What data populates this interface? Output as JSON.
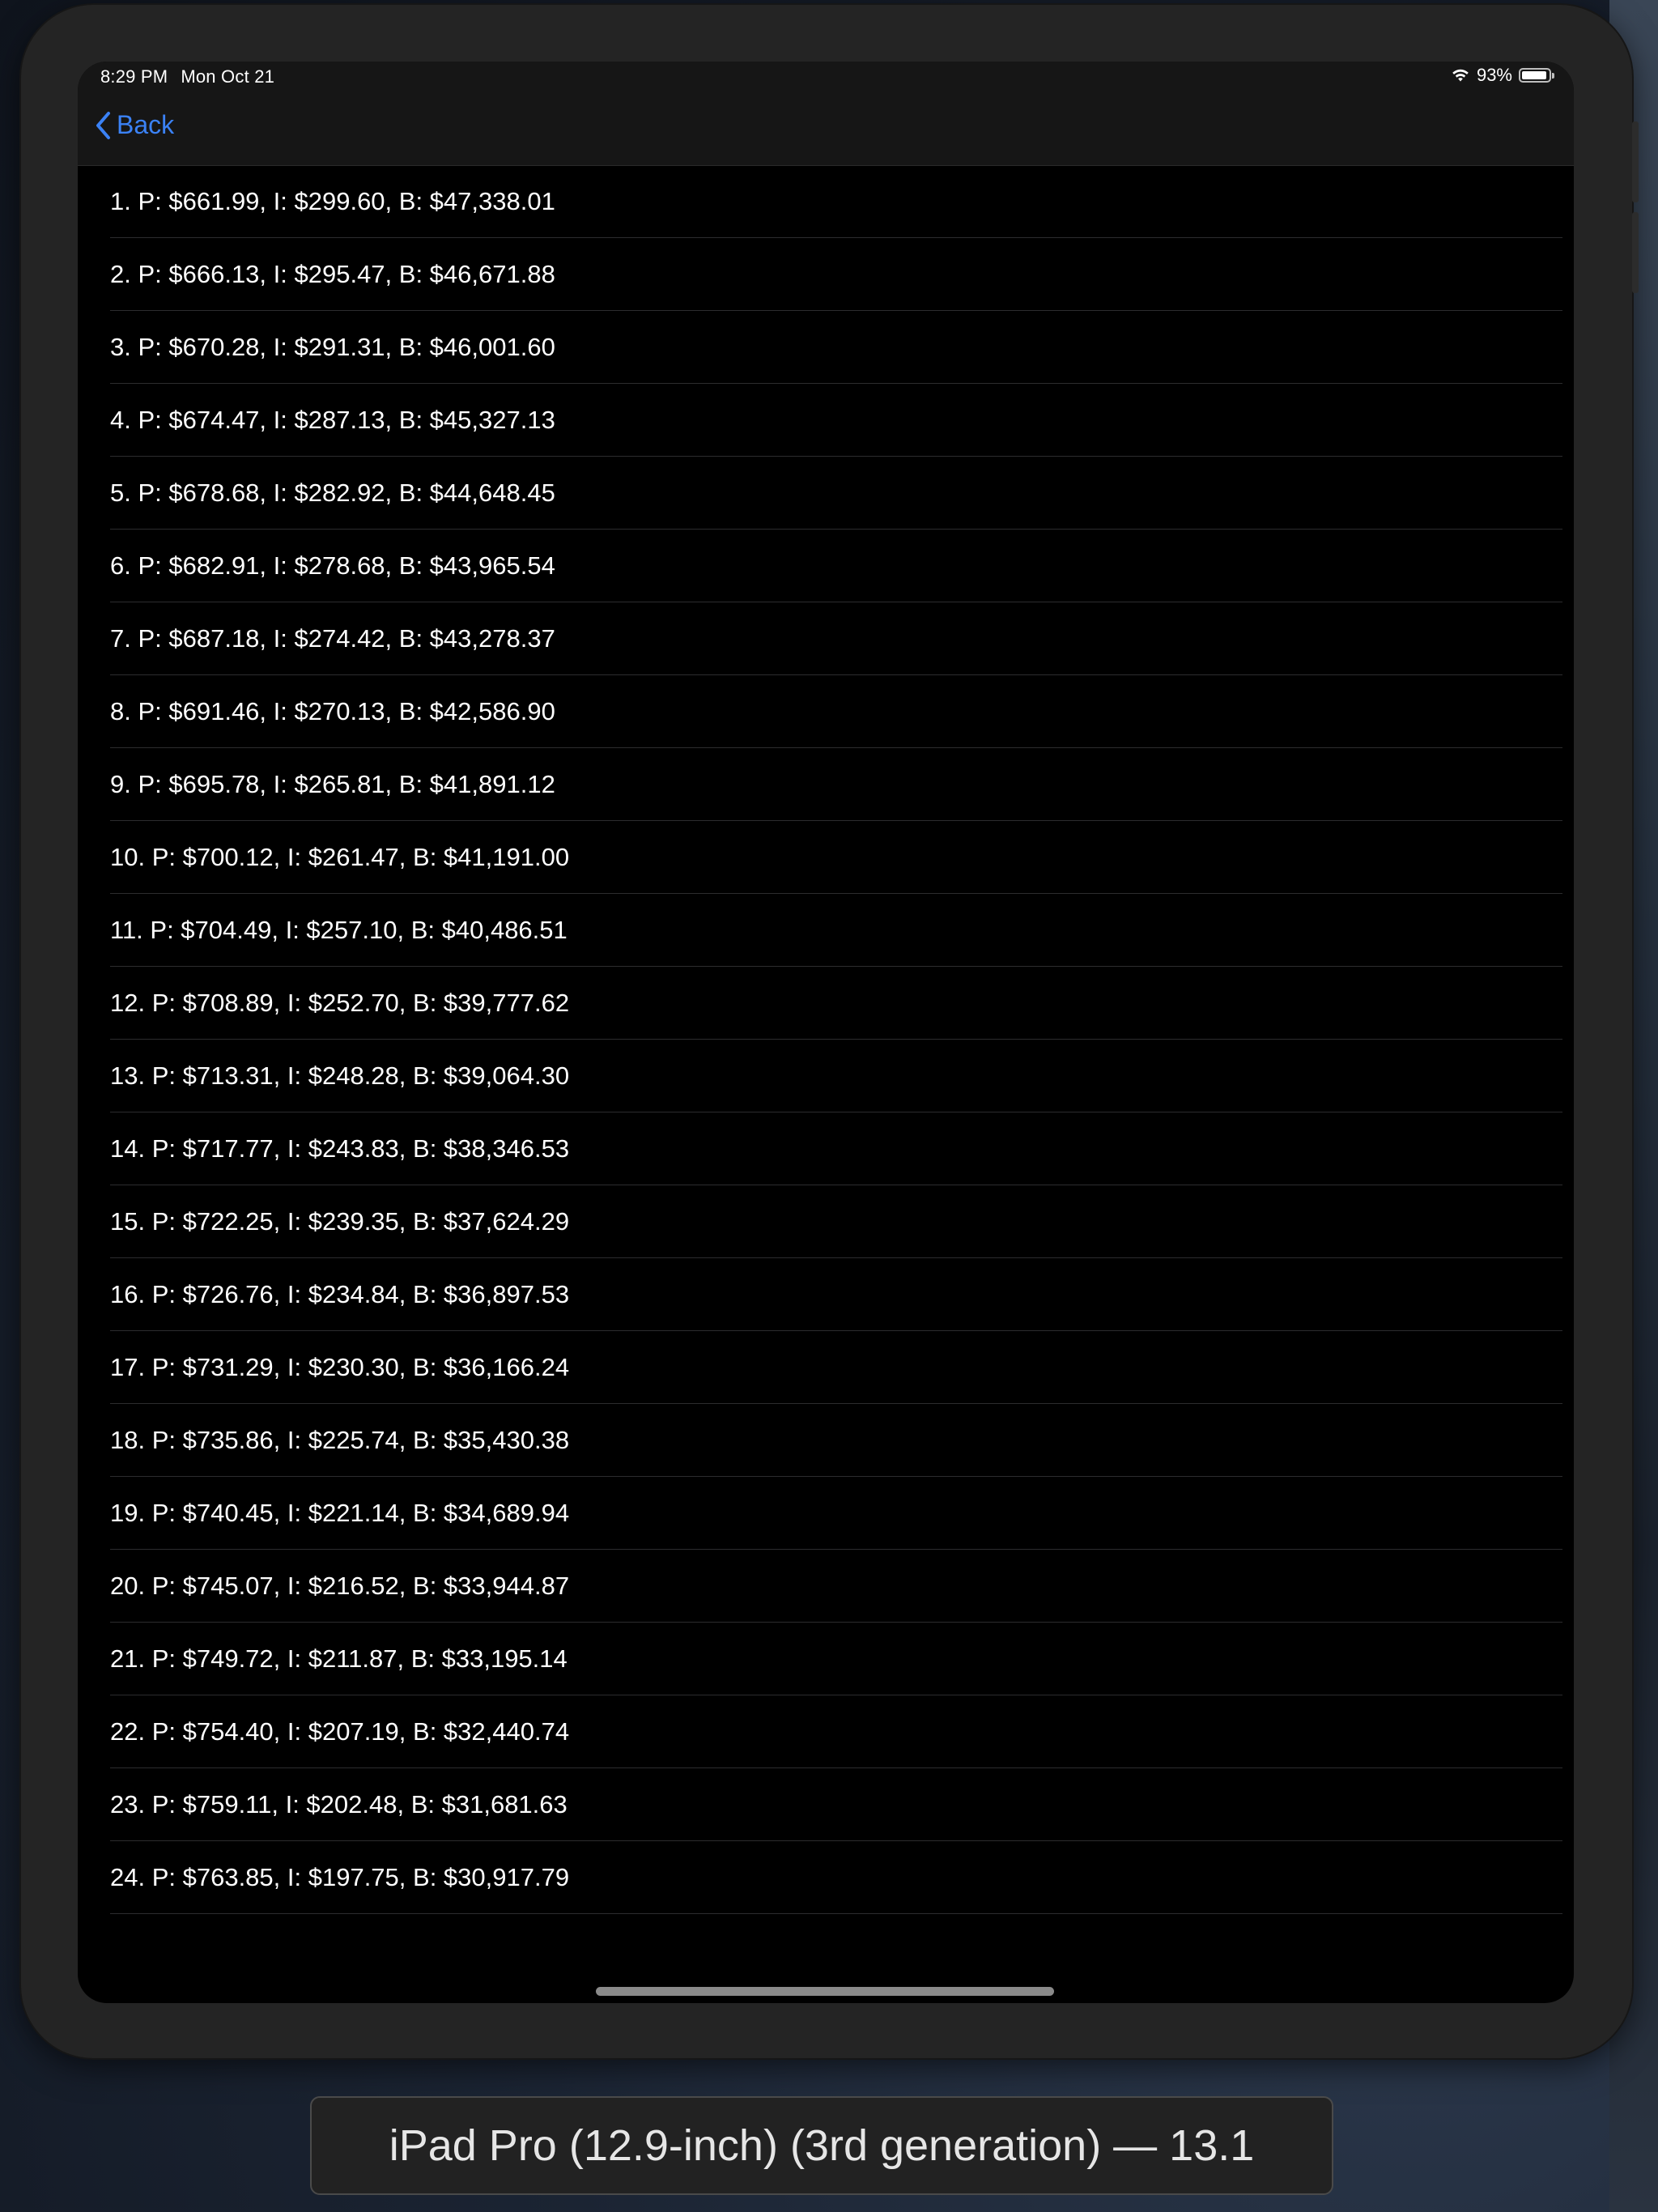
{
  "status_bar": {
    "time": "8:29 PM",
    "date": "Mon Oct 21",
    "battery": "93%",
    "battery_level": 0.93
  },
  "navigation": {
    "back_label": "Back"
  },
  "rows": [
    "1. P: $661.99, I: $299.60, B: $47,338.01",
    "2. P: $666.13, I: $295.47, B: $46,671.88",
    "3. P: $670.28, I: $291.31, B: $46,001.60",
    "4. P: $674.47, I: $287.13, B: $45,327.13",
    "5. P: $678.68, I: $282.92, B: $44,648.45",
    "6. P: $682.91, I: $278.68, B: $43,965.54",
    "7. P: $687.18, I: $274.42, B: $43,278.37",
    "8. P: $691.46, I: $270.13, B: $42,586.90",
    "9. P: $695.78, I: $265.81, B: $41,891.12",
    "10. P: $700.12, I: $261.47, B: $41,191.00",
    "11. P: $704.49, I: $257.10, B: $40,486.51",
    "12. P: $708.89, I: $252.70, B: $39,777.62",
    "13. P: $713.31, I: $248.28, B: $39,064.30",
    "14. P: $717.77, I: $243.83, B: $38,346.53",
    "15. P: $722.25, I: $239.35, B: $37,624.29",
    "16. P: $726.76, I: $234.84, B: $36,897.53",
    "17. P: $731.29, I: $230.30, B: $36,166.24",
    "18. P: $735.86, I: $225.74, B: $35,430.38",
    "19. P: $740.45, I: $221.14, B: $34,689.94",
    "20. P: $745.07, I: $216.52, B: $33,944.87",
    "21. P: $749.72, I: $211.87, B: $33,195.14",
    "22. P: $754.40, I: $207.19, B: $32,440.74",
    "23. P: $759.11, I: $202.48, B: $31,681.63",
    "24. P: $763.85, I: $197.75, B: $30,917.79"
  ],
  "device_label": "iPad Pro (12.9-inch) (3rd generation) — 13.1",
  "colors": {
    "accent": "#3b82f6",
    "screen_background": "#000000",
    "nav_background": "#161616",
    "separator": "#2c2c2e",
    "text": "#ffffff"
  },
  "icons": {
    "back": "chevron-left-icon",
    "wifi": "wifi-icon",
    "battery": "battery-icon"
  }
}
